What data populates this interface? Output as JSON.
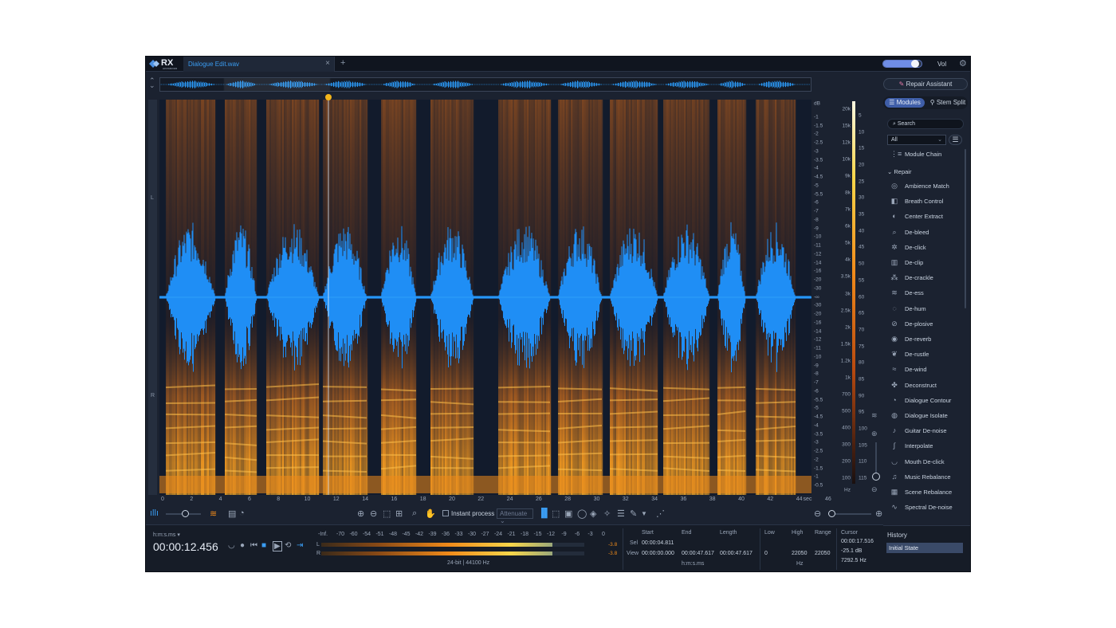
{
  "app": {
    "logo": "RX",
    "logo_sub": "ADVANCED"
  },
  "tab": {
    "file_name": "Dialogue Edit.wav",
    "close": "×",
    "new_tab": "+"
  },
  "volume": {
    "label": "Vol",
    "level": 0.85
  },
  "spectrogram": {
    "channels": [
      "L",
      "R"
    ],
    "time_ticks": [
      "0",
      "2",
      "4",
      "6",
      "8",
      "10",
      "12",
      "14",
      "16",
      "18",
      "20",
      "22",
      "24",
      "26",
      "28",
      "30",
      "32",
      "34",
      "36",
      "38",
      "40",
      "42",
      "44",
      "46"
    ],
    "time_unit": "sec",
    "db_axis_top": "dB",
    "db_ticks": [
      "-1",
      "-1.5",
      "-2",
      "-2.5",
      "-3",
      "-3.5",
      "-4",
      "-4.5",
      "-5",
      "-5.5",
      "-6",
      "-7",
      "-8",
      "-9",
      "-10",
      "-11",
      "-12",
      "-14",
      "-16",
      "-20",
      "-30",
      "-∞",
      "-30",
      "-20",
      "-16",
      "-14",
      "-12",
      "-11",
      "-10",
      "-9",
      "-8",
      "-7",
      "-6",
      "-5.5",
      "-5",
      "-4.5",
      "-4",
      "-3.5",
      "-3",
      "-2.5",
      "-2",
      "-1.5",
      "-1",
      "-0.5"
    ],
    "hz_ticks": [
      "20k",
      "15k",
      "12k",
      "10k",
      "9k",
      "8k",
      "7k",
      "6k",
      "5k",
      "4k",
      "3.5k",
      "3k",
      "2.5k",
      "2k",
      "1.5k",
      "1.2k",
      "1k",
      "700",
      "500",
      "400",
      "300",
      "200",
      "100"
    ],
    "hz_unit": "Hz",
    "color_ticks": [
      "5",
      "10",
      "15",
      "20",
      "25",
      "30",
      "35",
      "40",
      "45",
      "50",
      "55",
      "60",
      "65",
      "70",
      "75",
      "80",
      "85",
      "90",
      "95",
      "100",
      "105",
      "110",
      "115"
    ]
  },
  "toolbar": {
    "instant_process": "Instant process",
    "attenuate": "Attenuate"
  },
  "transport": {
    "format": "h:m:s.ms",
    "timecode": "00:00:12.456"
  },
  "meters": {
    "scale": [
      "-Inf.",
      "-70",
      "-60",
      "-54",
      "-51",
      "-48",
      "-45",
      "-42",
      "-39",
      "-36",
      "-33",
      "-30",
      "-27",
      "-24",
      "-21",
      "-18",
      "-15",
      "-12",
      "-9",
      "-6",
      "-3",
      "0"
    ],
    "left_label": "L",
    "right_label": "R",
    "left_peak": "-3.8",
    "right_peak": "-3.8",
    "left_level": 0.88,
    "right_level": 0.88,
    "format": "24-bit | 44100 Hz"
  },
  "selection": {
    "h_start": "Start",
    "h_end": "End",
    "h_length": "Length",
    "sel_label": "Sel",
    "view_label": "View",
    "sel_start": "00:00:04.811",
    "view_start": "00:00:00.000",
    "view_end": "00:00:47.617",
    "view_length": "00:00:47.617",
    "unit": "h:m:s.ms"
  },
  "frequency": {
    "h_low": "Low",
    "h_high": "High",
    "h_range": "Range",
    "low": "0",
    "high": "22050",
    "range": "22050",
    "unit": "Hz"
  },
  "cursor": {
    "label": "Cursor",
    "time": "00:00:17.516",
    "db": "-25.1 dB",
    "hz": "7292.5 Hz"
  },
  "panel": {
    "repair_assistant": "Repair Assistant",
    "modules_tab": "Modules",
    "stem_split_tab": "Stem Split",
    "search_placeholder": "Search",
    "filter_value": "All",
    "module_chain": "Module Chain",
    "section": "Repair",
    "modules": [
      {
        "label": "Ambience Match",
        "icon": "ambience-icon",
        "glyph": "◎"
      },
      {
        "label": "Breath Control",
        "icon": "breath-icon",
        "glyph": "◧"
      },
      {
        "label": "Center Extract",
        "icon": "center-icon",
        "glyph": "◐"
      },
      {
        "label": "De-bleed",
        "icon": "debleed-icon",
        "glyph": "⌕"
      },
      {
        "label": "De-click",
        "icon": "declick-icon",
        "glyph": "✲"
      },
      {
        "label": "De-clip",
        "icon": "declip-icon",
        "glyph": "▥"
      },
      {
        "label": "De-crackle",
        "icon": "decrackle-icon",
        "glyph": "⁂"
      },
      {
        "label": "De-ess",
        "icon": "deess-icon",
        "glyph": "≋"
      },
      {
        "label": "De-hum",
        "icon": "dehum-icon",
        "glyph": "◌"
      },
      {
        "label": "De-plosive",
        "icon": "deplosive-icon",
        "glyph": "⊘"
      },
      {
        "label": "De-reverb",
        "icon": "dereverb-icon",
        "glyph": "◉"
      },
      {
        "label": "De-rustle",
        "icon": "derustle-icon",
        "glyph": "❦"
      },
      {
        "label": "De-wind",
        "icon": "dewind-icon",
        "glyph": "≈"
      },
      {
        "label": "Deconstruct",
        "icon": "deconstruct-icon",
        "glyph": "✤"
      },
      {
        "label": "Dialogue Contour",
        "icon": "contour-icon",
        "glyph": "◔"
      },
      {
        "label": "Dialogue Isolate",
        "icon": "isolate-icon",
        "glyph": "◍"
      },
      {
        "label": "Guitar De-noise",
        "icon": "guitar-icon",
        "glyph": "♪"
      },
      {
        "label": "Interpolate",
        "icon": "interpolate-icon",
        "glyph": "∫"
      },
      {
        "label": "Mouth De-click",
        "icon": "mouth-icon",
        "glyph": "◡"
      },
      {
        "label": "Music Rebalance",
        "icon": "music-icon",
        "glyph": "♫"
      },
      {
        "label": "Scene Rebalance",
        "icon": "scene-icon",
        "glyph": "▦"
      },
      {
        "label": "Spectral De-noise",
        "icon": "spectral-icon",
        "glyph": "∿"
      }
    ]
  },
  "history": {
    "title": "History",
    "entry": "Initial State"
  },
  "colors": {
    "accent": "#3a9cf2",
    "wave": "#1f8ef5",
    "spectro_hot": "#f08a1a",
    "playhead": "#f2b51b"
  }
}
